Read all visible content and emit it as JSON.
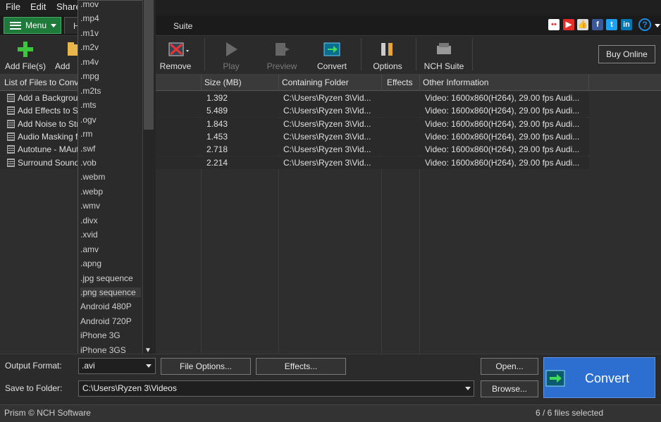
{
  "menubar": {
    "file": "File",
    "edit": "Edit",
    "share": "Share"
  },
  "tabs": {
    "menu_label": "Menu",
    "second_tab_partial": "H",
    "suite": "Suite"
  },
  "social_icons": [
    "flickr-icon",
    "youtube-icon",
    "like-icon",
    "facebook-icon",
    "twitter-icon",
    "linkedin-icon"
  ],
  "toolbar": {
    "add_files": "Add File(s)",
    "add_folder_partial": "Add Fo",
    "remove": "Remove",
    "play": "Play",
    "preview": "Preview",
    "convert": "Convert",
    "options": "Options",
    "nch_suite": "NCH Suite",
    "buy_online": "Buy Online"
  },
  "table": {
    "headers": {
      "files": "List of Files to Conve",
      "size": "Size (MB)",
      "folder": "Containing Folder",
      "effects": "Effects",
      "info": "Other Information"
    },
    "rows": [
      {
        "name": "Add a Backgroun",
        "size": "1.392",
        "folder": "C:\\Users\\Ryzen 3\\Vid...",
        "effects": "",
        "info": "Video: 1600x860(H264), 29.00 fps Audi..."
      },
      {
        "name": "Add Effects to S",
        "size": "5.489",
        "folder": "C:\\Users\\Ryzen 3\\Vid...",
        "effects": "",
        "info": "Video: 1600x860(H264), 29.00 fps Audi..."
      },
      {
        "name": "Add Noise to Stre",
        "size": "1.843",
        "folder": "C:\\Users\\Ryzen 3\\Vid...",
        "effects": "",
        "info": "Video: 1600x860(H264), 29.00 fps Audi..."
      },
      {
        "name": "Audio Masking fo",
        "size": "1.453",
        "folder": "C:\\Users\\Ryzen 3\\Vid...",
        "effects": "",
        "info": "Video: 1600x860(H264), 29.00 fps Audi..."
      },
      {
        "name": "Autotune - MAut",
        "size": "2.718",
        "folder": "C:\\Users\\Ryzen 3\\Vid...",
        "effects": "",
        "info": "Video: 1600x860(H264), 29.00 fps Audi..."
      },
      {
        "name": "Surround Sound",
        "size": "2.214",
        "folder": "C:\\Users\\Ryzen 3\\Vid...",
        "effects": "",
        "info": "Video: 1600x860(H264), 29.00 fps Audi..."
      }
    ]
  },
  "format_dropdown": {
    "options": [
      ".mov",
      ".mp4",
      ".m1v",
      ".m2v",
      ".m4v",
      ".mpg",
      ".m2ts",
      ".mts",
      ".ogv",
      ".rm",
      ".swf",
      ".vob",
      ".webm",
      ".webp",
      ".wmv",
      ".divx",
      ".xvid",
      ".amv",
      ".apng",
      ".jpg sequence",
      ".png sequence",
      "Android 480P",
      "Android 720P",
      "iPhone 3G",
      "iPhone 3GS"
    ],
    "highlighted": ".png sequence"
  },
  "bottom": {
    "output_format_label": "Output Format:",
    "output_format_value": ".avi",
    "file_options": "File Options...",
    "effects": "Effects...",
    "open": "Open...",
    "save_to_label": "Save to Folder:",
    "save_to_value": "C:\\Users\\Ryzen 3\\Videos",
    "browse": "Browse...",
    "convert": "Convert"
  },
  "status": {
    "left": "Prism © NCH Software",
    "right": "6 / 6 files selected"
  }
}
